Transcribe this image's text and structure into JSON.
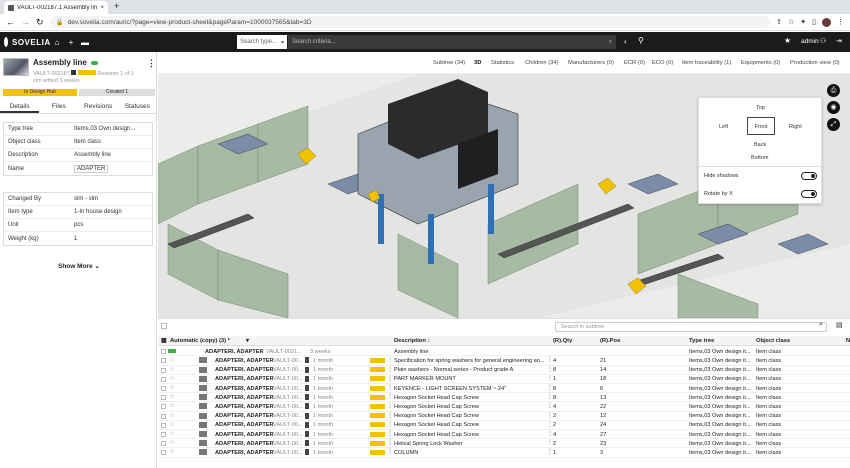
{
  "browser": {
    "tab_title": "VAULT-002187.1 Assembly line",
    "url": "dev.sovelia.com/auric/?page=view-product-sheet&pageParam=1000037565&tab=3D"
  },
  "app": {
    "logo": "SOVELIA",
    "search_type_placeholder": "Search type...",
    "search_criteria_placeholder": "Search criteria...",
    "user": "admin"
  },
  "item": {
    "title": "Assembly line",
    "code": "VAULT-002187",
    "revision_text": "Revision 1 of 1",
    "edited_text": "slm edited 3 weeks",
    "status_badge": "In Design Hub",
    "created_badge": "Created 1"
  },
  "left_tabs": [
    "Details",
    "Files",
    "Revisions",
    "Statuses"
  ],
  "details_group1": [
    {
      "label": "Type tree",
      "value": "Items,03 Own design..."
    },
    {
      "label": "Object class",
      "value": "Item class"
    },
    {
      "label": "Description",
      "value": "Assembly line"
    },
    {
      "label": "Name",
      "value": "ADAPTER"
    }
  ],
  "details_group2": [
    {
      "label": "Changed By",
      "value": "slm - slm"
    },
    {
      "label": "Item type",
      "value": "1-In house design"
    },
    {
      "label": "Unit",
      "value": "pcs"
    },
    {
      "label": "Weight (kg)",
      "value": "1"
    }
  ],
  "show_more": "Show More",
  "right_tabs": [
    "Subtree (34)",
    "3D",
    "Statistics",
    "Children (34)",
    "Manufacturers (0)",
    "ECR (0)",
    "ECO (0)",
    "Item traceability (1)",
    "Equipments (0)",
    "Production view (0)"
  ],
  "view_panel": {
    "top": "Top",
    "left": "Left",
    "front": "Front",
    "right": "Right",
    "back": "Back",
    "bottom": "Bottom",
    "hide_shadows": "Hide shadows",
    "rotate_by_x": "Rotate by X"
  },
  "subtree": {
    "search_placeholder": "Search in subtree",
    "columns": [
      "Automatic (copy) (3) *",
      "Description ↓",
      "(R).Qty",
      "(R).Pos",
      "Type tree",
      "Object class",
      "N"
    ],
    "root": {
      "name": "ADAPTERI, ADAPTER",
      "code": "VAULT-0021...",
      "age": "3 weeks",
      "description": "Assembly line",
      "type": "Items,03 Own design it...",
      "class": "Item class"
    },
    "rows": [
      {
        "name": "ADAPTERI, ADAPTER",
        "code": "VAULT-00...",
        "age": "1 month",
        "description": "Specification for spring washers for general engineering an...",
        "qty": "4",
        "pos": "21",
        "type": "Items,03 Own design it...",
        "class": "Item class"
      },
      {
        "name": "ADAPTERI, ADAPTER",
        "code": "VAULT-00...",
        "age": "1 month",
        "description": "Plain washers - Normal series - Product grade A",
        "qty": "8",
        "pos": "14",
        "type": "Items,03 Own design it...",
        "class": "Item class"
      },
      {
        "name": "ADAPTERI, ADAPTER",
        "code": "VAULT-00...",
        "age": "1 month",
        "description": "PART MARKER MOUNT",
        "qty": "1",
        "pos": "18",
        "type": "Items,03 Own design it...",
        "class": "Item class"
      },
      {
        "name": "ADAPTERI, ADAPTER",
        "code": "VAULT-00...",
        "age": "1 month",
        "description": "KEYENCE - LIGHT SCREEN SYSTEM ~ 24\"",
        "qty": "8",
        "pos": "6",
        "type": "Items,03 Own design it...",
        "class": "Item class"
      },
      {
        "name": "ADAPTERI, ADAPTER",
        "code": "VAULT-00...",
        "age": "1 month",
        "description": "Hexagon Socket Head Cap Screw",
        "qty": "8",
        "pos": "13",
        "type": "Items,03 Own design it...",
        "class": "Item class"
      },
      {
        "name": "ADAPTERI, ADAPTER",
        "code": "VAULT-00...",
        "age": "1 month",
        "description": "Hexagon Socket Head Cap Screw",
        "qty": "4",
        "pos": "22",
        "type": "Items,03 Own design it...",
        "class": "Item class"
      },
      {
        "name": "ADAPTERI, ADAPTER",
        "code": "VAULT-00...",
        "age": "1 month",
        "description": "Hexagon Socket Head Cap Screw",
        "qty": "2",
        "pos": "12",
        "type": "Items,03 Own design it...",
        "class": "Item class"
      },
      {
        "name": "ADAPTERI, ADAPTER",
        "code": "VAULT-00...",
        "age": "1 month",
        "description": "Hexagon Socket Head Cap Screw",
        "qty": "2",
        "pos": "24",
        "type": "Items,03 Own design it...",
        "class": "Item class"
      },
      {
        "name": "ADAPTERI, ADAPTER",
        "code": "VAULT-00...",
        "age": "1 month",
        "description": "Hexagon Socket Head Cap Screw",
        "qty": "4",
        "pos": "27",
        "type": "Items,03 Own design it...",
        "class": "Item class"
      },
      {
        "name": "ADAPTERI, ADAPTER",
        "code": "VAULT-00...",
        "age": "1 month",
        "description": "Helical Spring Lock Washer",
        "qty": "2",
        "pos": "23",
        "type": "Items,03 Own design it...",
        "class": "Item class"
      },
      {
        "name": "ADAPTERI, ADAPTER",
        "code": "VAULT-00...",
        "age": "1 month",
        "description": "COLUMN",
        "qty": "1",
        "pos": "3",
        "type": "Items,03 Own design it...",
        "class": "Item class"
      }
    ]
  },
  "colors": {
    "accent_yellow": "#f2c200",
    "header_dark": "#1b1b1b",
    "badge_green": "#3cb043"
  }
}
